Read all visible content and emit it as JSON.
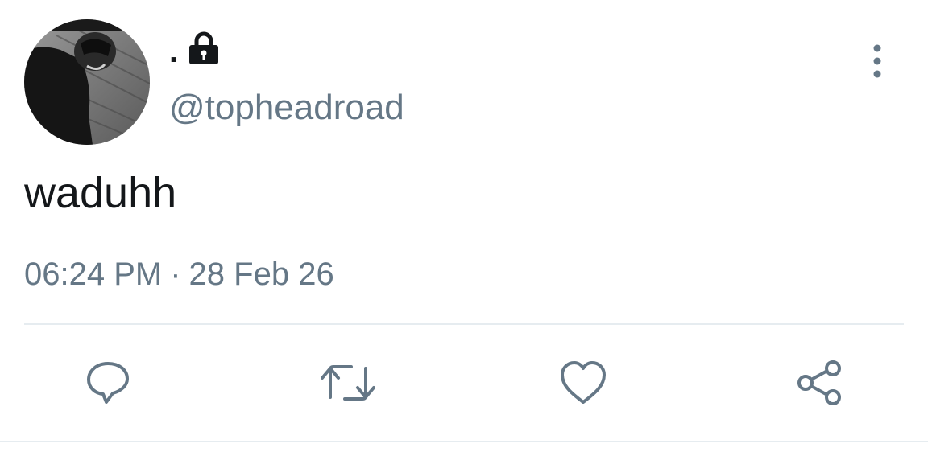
{
  "tweet": {
    "display_name": ".",
    "protected_icon": "lock-icon",
    "handle": "@topheadroad",
    "text": "waduhh",
    "time": "06:24 PM",
    "separator": "·",
    "date": "28 Feb 26"
  },
  "icons": {
    "menu": "more-vertical-icon",
    "reply": "reply-icon",
    "retweet": "retweet-icon",
    "like": "heart-icon",
    "share": "share-icon"
  },
  "colors": {
    "text_primary": "#14171a",
    "text_secondary": "#657786",
    "divider": "#e6ecf0"
  }
}
